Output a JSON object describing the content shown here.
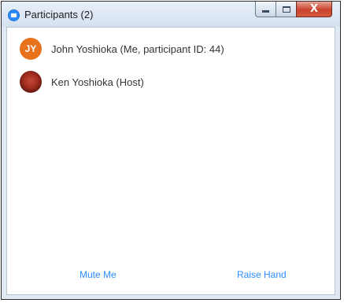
{
  "window": {
    "title": "Participants (2)",
    "controls": {
      "minimize_icon": "minimize-icon",
      "maximize_icon": "maximize-icon",
      "close_label": "X"
    }
  },
  "participants": [
    {
      "name": "John Yoshioka (Me, participant ID: 44)",
      "initials": "JY",
      "avatar_color": "#e8711c"
    },
    {
      "name": "Ken Yoshioka (Host)",
      "avatar": "photo-avatar"
    }
  ],
  "footer": {
    "mute_label": "Mute Me",
    "raise_label": "Raise Hand"
  },
  "colors": {
    "accent": "#2d8cff",
    "close_button": "#c8432b"
  }
}
